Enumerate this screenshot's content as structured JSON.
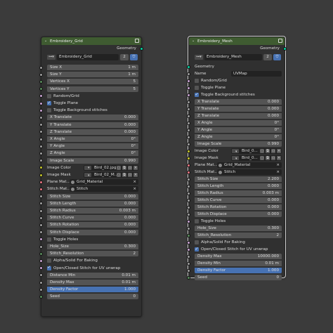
{
  "node_left": {
    "title": "Embroidery_Grid",
    "collapse_icon": "chevron-down-icon",
    "output_label": "Geometry",
    "group_name": "Embroidery_Grid",
    "group_users": "2",
    "rows": [
      {
        "kind": "field",
        "label": "Size X",
        "value": "1 m",
        "sock": "val",
        "pos": "first"
      },
      {
        "kind": "field",
        "label": "Size Y",
        "value": "1 m",
        "sock": "val",
        "pos": "last"
      },
      {
        "kind": "field",
        "label": "Vertices X",
        "value": "5",
        "sock": "int",
        "pos": "first"
      },
      {
        "kind": "field",
        "label": "Vertices Y",
        "value": "5",
        "sock": "int",
        "pos": "last"
      },
      {
        "kind": "check",
        "label": "Random/Grid",
        "checked": false
      },
      {
        "kind": "check",
        "label": "Toggle Plane",
        "checked": true
      },
      {
        "kind": "check",
        "label": "Toggle Background stitches",
        "checked": false
      },
      {
        "kind": "field",
        "label": "X Translate",
        "value": "0.000",
        "sock": "val",
        "pos": "first"
      },
      {
        "kind": "field",
        "label": "Y Translate",
        "value": "0.000",
        "sock": "val",
        "pos": "mid"
      },
      {
        "kind": "field",
        "label": "Z Translate",
        "value": "0.000",
        "sock": "val",
        "pos": "mid"
      },
      {
        "kind": "field",
        "label": "X Angle",
        "value": "0°",
        "sock": "val",
        "pos": "mid"
      },
      {
        "kind": "field",
        "label": "Y Angle",
        "value": "0°",
        "sock": "val",
        "pos": "mid"
      },
      {
        "kind": "field",
        "label": "Z Angle",
        "value": "0°",
        "sock": "val",
        "pos": "mid"
      },
      {
        "kind": "field",
        "label": "Image Scale",
        "value": "0.990",
        "sock": "val",
        "pos": "last"
      },
      {
        "kind": "image",
        "label": "Image Color",
        "file": "Bird_02.jpg"
      },
      {
        "kind": "image",
        "label": "Image Mask",
        "file": "Bird_02_M..."
      },
      {
        "kind": "mat",
        "label": "Plane Mat...",
        "value": "Grid_Material"
      },
      {
        "kind": "mat",
        "label": "Stitch Mat...",
        "value": "Stitch"
      },
      {
        "kind": "field",
        "label": "Stitch Size",
        "value": "0.000",
        "sock": "val",
        "pos": "first"
      },
      {
        "kind": "field",
        "label": "Stitch Length",
        "value": "0.000",
        "sock": "val",
        "pos": "mid"
      },
      {
        "kind": "field",
        "label": "Stitch Radius",
        "value": "0.003 m",
        "sock": "val",
        "pos": "mid"
      },
      {
        "kind": "field",
        "label": "Stitch Curve",
        "value": "0.000",
        "sock": "val",
        "pos": "mid"
      },
      {
        "kind": "field",
        "label": "Stitch Rotation",
        "value": "0.000",
        "sock": "val",
        "pos": "mid"
      },
      {
        "kind": "field",
        "label": "Stitch Displace",
        "value": "0.000",
        "sock": "val",
        "pos": "last"
      },
      {
        "kind": "check",
        "label": "Toggle Holes",
        "checked": false
      },
      {
        "kind": "field",
        "label": "Hole_Size",
        "value": "0.300",
        "sock": "val",
        "pos": "first"
      },
      {
        "kind": "field",
        "label": "Stitch_Resolution",
        "value": "2",
        "sock": "int",
        "pos": "last"
      },
      {
        "kind": "check",
        "label": "Alpha/Solid For Baking",
        "checked": false
      },
      {
        "kind": "check",
        "label": "Open/Closed Stitch for UV unwrap",
        "checked": true
      },
      {
        "kind": "field",
        "label": "Distance Min",
        "value": "0.01 m",
        "sock": "val",
        "pos": "first"
      },
      {
        "kind": "field",
        "label": "Density Max",
        "value": "0.01 m",
        "sock": "val",
        "pos": "mid"
      },
      {
        "kind": "field",
        "label": "Density Factor",
        "value": "1.000",
        "sock": "val",
        "pos": "last",
        "accent": true
      },
      {
        "kind": "field",
        "label": "Seed",
        "value": "0",
        "sock": "int",
        "pos": "single"
      }
    ]
  },
  "node_right": {
    "title": "Embroidery_Mesh",
    "collapse_icon": "chevron-down-icon",
    "output_label": "Geometry",
    "group_name": "Embroidery_Mesh",
    "group_users": "2",
    "rows": [
      {
        "kind": "insock",
        "label": "Geometry"
      },
      {
        "kind": "text",
        "label": "Name",
        "value": "UVMap"
      },
      {
        "kind": "check",
        "label": "Random/Grid",
        "checked": false
      },
      {
        "kind": "check",
        "label": "Toggle Plane",
        "checked": false
      },
      {
        "kind": "check",
        "label": "Toggle Background stitches",
        "checked": true
      },
      {
        "kind": "field",
        "label": "X Translate",
        "value": "0.000",
        "sock": "val",
        "pos": "first"
      },
      {
        "kind": "field",
        "label": "Y Translate",
        "value": "0.000",
        "sock": "val",
        "pos": "mid"
      },
      {
        "kind": "field",
        "label": "Z Translate",
        "value": "0.000",
        "sock": "val",
        "pos": "mid"
      },
      {
        "kind": "field",
        "label": "X Angle",
        "value": "0°",
        "sock": "val",
        "pos": "mid"
      },
      {
        "kind": "field",
        "label": "Y Angle",
        "value": "0°",
        "sock": "val",
        "pos": "mid"
      },
      {
        "kind": "field",
        "label": "Z Angle",
        "value": "0°",
        "sock": "val",
        "pos": "mid"
      },
      {
        "kind": "field",
        "label": "Image Scale",
        "value": "0.990",
        "sock": "val",
        "pos": "last"
      },
      {
        "kind": "image",
        "label": "Image Color",
        "file": "Bird_0..."
      },
      {
        "kind": "image",
        "label": "Image Mask",
        "file": "Bird_0..."
      },
      {
        "kind": "mat",
        "label": "Plane Mat...",
        "value": "Grid_Material"
      },
      {
        "kind": "mat",
        "label": "Stitch Mat...",
        "value": "Stitch"
      },
      {
        "kind": "field",
        "label": "Stitch Size",
        "value": "2.200",
        "sock": "val",
        "pos": "first"
      },
      {
        "kind": "field",
        "label": "Stitch Length",
        "value": "0.000",
        "sock": "val",
        "pos": "mid"
      },
      {
        "kind": "field",
        "label": "Stitch Radius",
        "value": "0.003 m",
        "sock": "val",
        "pos": "mid"
      },
      {
        "kind": "field",
        "label": "Stitch Curve",
        "value": "0.000",
        "sock": "val",
        "pos": "mid"
      },
      {
        "kind": "field",
        "label": "Stitch Rotation",
        "value": "0.000",
        "sock": "val",
        "pos": "mid"
      },
      {
        "kind": "field",
        "label": "Stitch Displace",
        "value": "0.000",
        "sock": "val",
        "pos": "last"
      },
      {
        "kind": "check",
        "label": "Toggle Holes",
        "checked": false
      },
      {
        "kind": "field",
        "label": "Hole_Size",
        "value": "0.300",
        "sock": "val",
        "pos": "first"
      },
      {
        "kind": "field",
        "label": "Stitch_Resolution",
        "value": "2",
        "sock": "int",
        "pos": "last"
      },
      {
        "kind": "check",
        "label": "Alpha/Solid For Baking",
        "checked": false
      },
      {
        "kind": "check",
        "label": "Open/Closed Stitch for UV unwrap",
        "checked": true
      },
      {
        "kind": "field",
        "label": "Density Max",
        "value": "10000.000",
        "sock": "val",
        "pos": "first"
      },
      {
        "kind": "field",
        "label": "Density Min",
        "value": "0.01 m",
        "sock": "val",
        "pos": "mid"
      },
      {
        "kind": "field",
        "label": "Density Factor",
        "value": "1.000",
        "sock": "val",
        "pos": "last",
        "accent": true
      },
      {
        "kind": "field",
        "label": "Seed",
        "value": "0",
        "sock": "int",
        "pos": "single"
      }
    ]
  },
  "colors": {
    "header": "#3f5b31",
    "node_body": "#303030",
    "field": "#545454",
    "accent": "#4772b3",
    "geometry_socket": "#00d6a3",
    "value_socket": "#a1a1a1",
    "material_socket": "#eb7582",
    "color_socket": "#c7c729"
  }
}
